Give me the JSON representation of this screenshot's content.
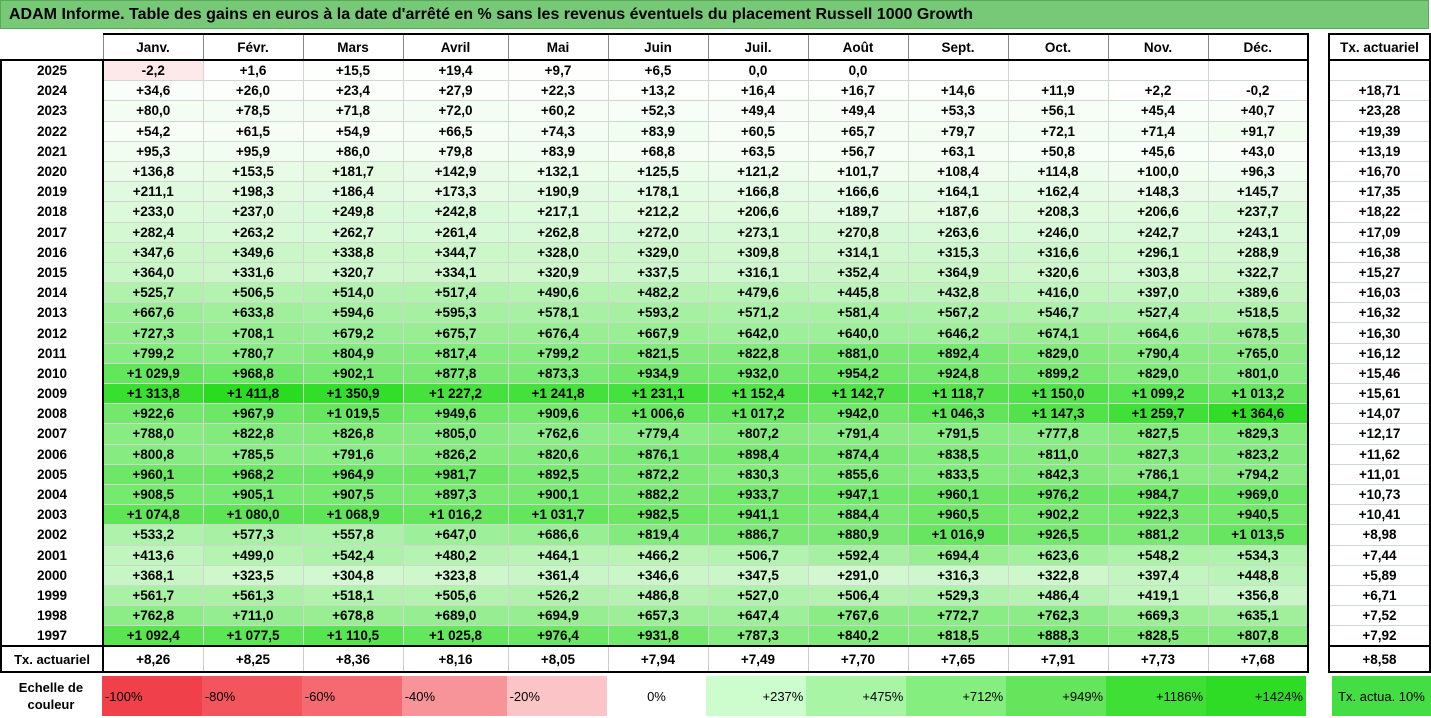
{
  "title": "ADAM Informe. Table des gains en euros à la date d'arrêté en % sans les revenus éventuels du placement Russell 1000 Growth",
  "side_header": "Tx. actuariel",
  "footer_label": "Tx. actuariel",
  "legend": {
    "label": "Echelle de couleur",
    "side_label": "Tx. actua. 10%",
    "side_color": "#44dd44",
    "cells": [
      {
        "text": "-100%",
        "color": "#f0404a",
        "align": "l"
      },
      {
        "text": "-80%",
        "color": "#f2555c",
        "align": "l"
      },
      {
        "text": "-60%",
        "color": "#f46a70",
        "align": "l"
      },
      {
        "text": "-40%",
        "color": "#f79499",
        "align": "l"
      },
      {
        "text": "-20%",
        "color": "#fbc4c6",
        "align": "l"
      },
      {
        "text": "0%",
        "color": "#ffffff",
        "align": "c"
      },
      {
        "text": "+237%",
        "color": "#cdfccd",
        "align": "r"
      },
      {
        "text": "+475%",
        "color": "#a9f5a6",
        "align": "r"
      },
      {
        "text": "+712%",
        "color": "#84ee7e",
        "align": "r"
      },
      {
        "text": "+949%",
        "color": "#64e55c",
        "align": "r"
      },
      {
        "text": "+1186%",
        "color": "#3ee036",
        "align": "r"
      },
      {
        "text": "+1424%",
        "color": "#2edb25",
        "align": "r"
      }
    ]
  },
  "chart_data": {
    "type": "table",
    "title": "ADAM Informe. Table des gains en euros à la date d'arrêté en % sans les revenus éventuels du placement Russell 1000 Growth",
    "months": [
      "Janv.",
      "Févr.",
      "Mars",
      "Avril",
      "Mai",
      "Juin",
      "Juil.",
      "Août",
      "Sept.",
      "Oct.",
      "Nov.",
      "Déc."
    ],
    "rows": [
      {
        "year": "2025",
        "values": [
          "-2,2",
          "+1,6",
          "+15,5",
          "+19,4",
          "+9,7",
          "+6,5",
          "0,0",
          "0,0",
          "",
          "",
          "",
          ""
        ],
        "rate": ""
      },
      {
        "year": "2024",
        "values": [
          "+34,6",
          "+26,0",
          "+23,4",
          "+27,9",
          "+22,3",
          "+13,2",
          "+16,4",
          "+16,7",
          "+14,6",
          "+11,9",
          "+2,2",
          "-0,2"
        ],
        "rate": "+18,71"
      },
      {
        "year": "2023",
        "values": [
          "+80,0",
          "+78,5",
          "+71,8",
          "+72,0",
          "+60,2",
          "+52,3",
          "+49,4",
          "+49,4",
          "+53,3",
          "+56,1",
          "+45,4",
          "+40,7"
        ],
        "rate": "+23,28"
      },
      {
        "year": "2022",
        "values": [
          "+54,2",
          "+61,5",
          "+54,9",
          "+66,5",
          "+74,3",
          "+83,9",
          "+60,5",
          "+65,7",
          "+79,7",
          "+72,1",
          "+71,4",
          "+91,7"
        ],
        "rate": "+19,39"
      },
      {
        "year": "2021",
        "values": [
          "+95,3",
          "+95,9",
          "+86,0",
          "+79,8",
          "+83,9",
          "+68,8",
          "+63,5",
          "+56,7",
          "+63,1",
          "+50,8",
          "+45,6",
          "+43,0"
        ],
        "rate": "+13,19"
      },
      {
        "year": "2020",
        "values": [
          "+136,8",
          "+153,5",
          "+181,7",
          "+142,9",
          "+132,1",
          "+125,5",
          "+121,2",
          "+101,7",
          "+108,4",
          "+114,8",
          "+100,0",
          "+96,3"
        ],
        "rate": "+16,70"
      },
      {
        "year": "2019",
        "values": [
          "+211,1",
          "+198,3",
          "+186,4",
          "+173,3",
          "+190,9",
          "+178,1",
          "+166,8",
          "+166,6",
          "+164,1",
          "+162,4",
          "+148,3",
          "+145,7"
        ],
        "rate": "+17,35"
      },
      {
        "year": "2018",
        "values": [
          "+233,0",
          "+237,0",
          "+249,8",
          "+242,8",
          "+217,1",
          "+212,2",
          "+206,6",
          "+189,7",
          "+187,6",
          "+208,3",
          "+206,6",
          "+237,7"
        ],
        "rate": "+18,22"
      },
      {
        "year": "2017",
        "values": [
          "+282,4",
          "+263,2",
          "+262,7",
          "+261,4",
          "+262,8",
          "+272,0",
          "+273,1",
          "+270,8",
          "+263,6",
          "+246,0",
          "+242,7",
          "+243,1"
        ],
        "rate": "+17,09"
      },
      {
        "year": "2016",
        "values": [
          "+347,6",
          "+349,6",
          "+338,8",
          "+344,7",
          "+328,0",
          "+329,0",
          "+309,8",
          "+314,1",
          "+315,3",
          "+316,6",
          "+296,1",
          "+288,9"
        ],
        "rate": "+16,38"
      },
      {
        "year": "2015",
        "values": [
          "+364,0",
          "+331,6",
          "+320,7",
          "+334,1",
          "+320,9",
          "+337,5",
          "+316,1",
          "+352,4",
          "+364,9",
          "+320,6",
          "+303,8",
          "+322,7"
        ],
        "rate": "+15,27"
      },
      {
        "year": "2014",
        "values": [
          "+525,7",
          "+506,5",
          "+514,0",
          "+517,4",
          "+490,6",
          "+482,2",
          "+479,6",
          "+445,8",
          "+432,8",
          "+416,0",
          "+397,0",
          "+389,6"
        ],
        "rate": "+16,03"
      },
      {
        "year": "2013",
        "values": [
          "+667,6",
          "+633,8",
          "+594,6",
          "+595,3",
          "+578,1",
          "+593,2",
          "+571,2",
          "+581,4",
          "+567,2",
          "+546,7",
          "+527,4",
          "+518,5"
        ],
        "rate": "+16,32"
      },
      {
        "year": "2012",
        "values": [
          "+727,3",
          "+708,1",
          "+679,2",
          "+675,7",
          "+676,4",
          "+667,9",
          "+642,0",
          "+640,0",
          "+646,2",
          "+674,1",
          "+664,6",
          "+678,5"
        ],
        "rate": "+16,30"
      },
      {
        "year": "2011",
        "values": [
          "+799,2",
          "+780,7",
          "+804,9",
          "+817,4",
          "+799,2",
          "+821,5",
          "+822,8",
          "+881,0",
          "+892,4",
          "+829,0",
          "+790,4",
          "+765,0"
        ],
        "rate": "+16,12"
      },
      {
        "year": "2010",
        "values": [
          "+1 029,9",
          "+968,8",
          "+902,1",
          "+877,8",
          "+873,3",
          "+934,9",
          "+932,0",
          "+954,2",
          "+924,8",
          "+899,2",
          "+829,0",
          "+801,0"
        ],
        "rate": "+15,46"
      },
      {
        "year": "2009",
        "values": [
          "+1 313,8",
          "+1 411,8",
          "+1 350,9",
          "+1 227,2",
          "+1 241,8",
          "+1 231,1",
          "+1 152,4",
          "+1 142,7",
          "+1 118,7",
          "+1 150,0",
          "+1 099,2",
          "+1 013,2"
        ],
        "rate": "+15,61"
      },
      {
        "year": "2008",
        "values": [
          "+922,6",
          "+967,9",
          "+1 019,5",
          "+949,6",
          "+909,6",
          "+1 006,6",
          "+1 017,2",
          "+942,0",
          "+1 046,3",
          "+1 147,3",
          "+1 259,7",
          "+1 364,6"
        ],
        "rate": "+14,07"
      },
      {
        "year": "2007",
        "values": [
          "+788,0",
          "+822,8",
          "+826,8",
          "+805,0",
          "+762,6",
          "+779,4",
          "+807,2",
          "+791,4",
          "+791,5",
          "+777,8",
          "+827,5",
          "+829,3"
        ],
        "rate": "+12,17"
      },
      {
        "year": "2006",
        "values": [
          "+800,8",
          "+785,5",
          "+791,6",
          "+826,2",
          "+820,6",
          "+876,1",
          "+898,4",
          "+874,4",
          "+838,5",
          "+811,0",
          "+827,3",
          "+823,2"
        ],
        "rate": "+11,62"
      },
      {
        "year": "2005",
        "values": [
          "+960,1",
          "+968,2",
          "+964,9",
          "+981,7",
          "+892,5",
          "+872,2",
          "+830,3",
          "+855,6",
          "+833,5",
          "+842,3",
          "+786,1",
          "+794,2"
        ],
        "rate": "+11,01"
      },
      {
        "year": "2004",
        "values": [
          "+908,5",
          "+905,1",
          "+907,5",
          "+897,3",
          "+900,1",
          "+882,2",
          "+933,7",
          "+947,1",
          "+960,1",
          "+976,2",
          "+984,7",
          "+969,0"
        ],
        "rate": "+10,73"
      },
      {
        "year": "2003",
        "values": [
          "+1 074,8",
          "+1 080,0",
          "+1 068,9",
          "+1 016,2",
          "+1 031,7",
          "+982,5",
          "+941,1",
          "+884,4",
          "+960,5",
          "+902,2",
          "+922,3",
          "+940,5"
        ],
        "rate": "+10,41"
      },
      {
        "year": "2002",
        "values": [
          "+533,2",
          "+577,3",
          "+557,8",
          "+647,0",
          "+686,6",
          "+819,4",
          "+886,7",
          "+880,9",
          "+1 016,9",
          "+926,5",
          "+881,2",
          "+1 013,5"
        ],
        "rate": "+8,98"
      },
      {
        "year": "2001",
        "values": [
          "+413,6",
          "+499,0",
          "+542,4",
          "+480,2",
          "+464,1",
          "+466,2",
          "+506,7",
          "+592,4",
          "+694,4",
          "+623,6",
          "+548,2",
          "+534,3"
        ],
        "rate": "+7,44"
      },
      {
        "year": "2000",
        "values": [
          "+368,1",
          "+323,5",
          "+304,8",
          "+323,8",
          "+361,4",
          "+346,6",
          "+347,5",
          "+291,0",
          "+316,3",
          "+322,8",
          "+397,4",
          "+448,8"
        ],
        "rate": "+5,89"
      },
      {
        "year": "1999",
        "values": [
          "+561,7",
          "+561,3",
          "+518,1",
          "+505,6",
          "+526,2",
          "+486,8",
          "+527,0",
          "+506,4",
          "+529,3",
          "+486,4",
          "+419,1",
          "+356,8"
        ],
        "rate": "+6,71"
      },
      {
        "year": "1998",
        "values": [
          "+762,8",
          "+711,0",
          "+678,8",
          "+689,0",
          "+694,9",
          "+657,3",
          "+647,4",
          "+767,6",
          "+772,7",
          "+762,3",
          "+669,3",
          "+635,1"
        ],
        "rate": "+7,52"
      },
      {
        "year": "1997",
        "values": [
          "+1 092,4",
          "+1 077,5",
          "+1 110,5",
          "+1 025,8",
          "+976,4",
          "+931,8",
          "+787,3",
          "+840,2",
          "+818,5",
          "+888,3",
          "+828,5",
          "+807,8"
        ],
        "rate": "+7,92"
      }
    ],
    "footer": [
      "+8,26",
      "+8,25",
      "+8,36",
      "+8,16",
      "+8,05",
      "+7,94",
      "+7,49",
      "+7,70",
      "+7,65",
      "+7,91",
      "+7,73",
      "+7,68"
    ],
    "footer_rate": "+8,58"
  }
}
